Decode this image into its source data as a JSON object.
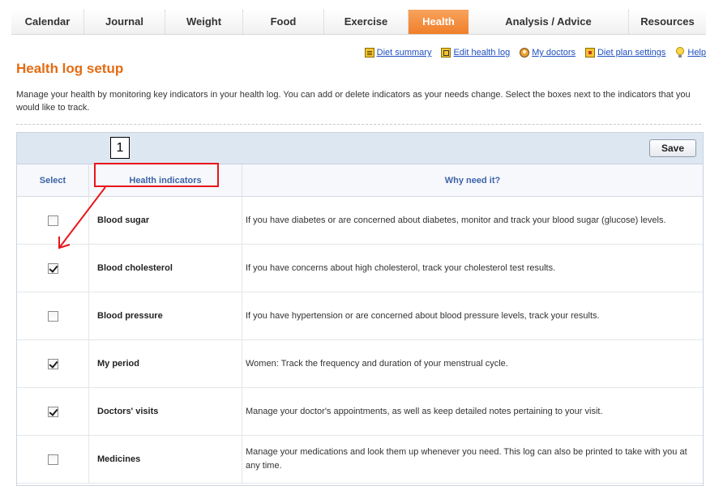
{
  "nav": {
    "tabs": [
      {
        "label": "Calendar"
      },
      {
        "label": "Journal"
      },
      {
        "label": "Weight"
      },
      {
        "label": "Food"
      },
      {
        "label": "Exercise"
      },
      {
        "label": "Health",
        "active": true
      },
      {
        "label": "Analysis / Advice"
      },
      {
        "label": "Resources"
      }
    ]
  },
  "links": [
    {
      "label": "Diet summary",
      "icon": "diet-summary-icon"
    },
    {
      "label": "Edit health log",
      "icon": "edit-health-log-icon"
    },
    {
      "label": "My doctors",
      "icon": "doctor-icon"
    },
    {
      "label": "Diet plan settings",
      "icon": "settings-icon"
    },
    {
      "label": "Help",
      "icon": "lightbulb-icon"
    }
  ],
  "page": {
    "title": "Health log setup",
    "intro": "Manage your health by monitoring key indicators in your health log. You can add or delete indicators as your needs change. Select the boxes next to the indicators that you would like to track."
  },
  "toolbar": {
    "save_label": "Save"
  },
  "table": {
    "headers": {
      "select": "Select",
      "indicator": "Health indicators",
      "why": "Why need it?"
    },
    "rows": [
      {
        "indicator": "Blood sugar",
        "checked": false,
        "why": "If you have diabetes or are concerned about diabetes, monitor and track your blood sugar (glucose) levels."
      },
      {
        "indicator": "Blood cholesterol",
        "checked": true,
        "why": "If you have concerns about high cholesterol, track your cholesterol test results."
      },
      {
        "indicator": "Blood pressure",
        "checked": false,
        "why": "If you have hypertension or are concerned about blood pressure levels, track your results."
      },
      {
        "indicator": "My period",
        "checked": true,
        "why": "Women: Track the frequency and duration of your menstrual cycle."
      },
      {
        "indicator": "Doctors' visits",
        "checked": true,
        "why": "Manage your doctor's appointments, as well as keep detailed notes pertaining to your visit."
      },
      {
        "indicator": "Medicines",
        "checked": false,
        "why": "Manage your medications and look them up whenever you need. This log can also be printed to take with you at any time."
      }
    ]
  },
  "annotation": {
    "number": "1",
    "color": "#e8161b"
  },
  "colors": {
    "accent": "#f07f2a",
    "title": "#e56b12",
    "link": "#1f4fbf",
    "header_text": "#3d63a8"
  }
}
